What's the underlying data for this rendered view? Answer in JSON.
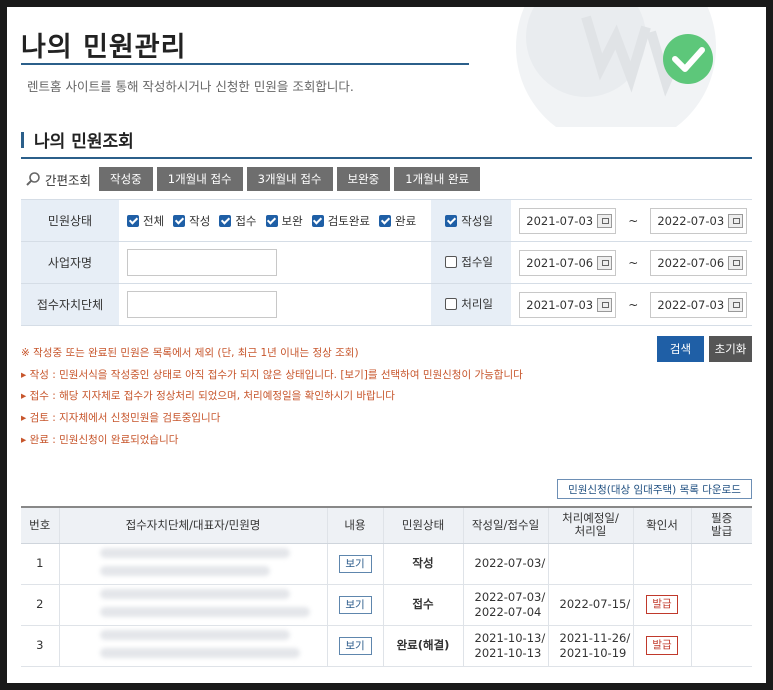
{
  "header": {
    "title": "나의 민원관리",
    "subtitle": "렌트홈 사이트를 통해 작성하시거나 신청한 민원을 조회합니다."
  },
  "section": {
    "title": "나의 민원조회"
  },
  "quick_search": {
    "label": "간편조회",
    "buttons": [
      "작성중",
      "1개월내 접수",
      "3개월내 접수",
      "보완중",
      "1개월내 완료"
    ]
  },
  "filter": {
    "status_label": "민원상태",
    "status_options": [
      {
        "label": "전체",
        "checked": true
      },
      {
        "label": "작성",
        "checked": true
      },
      {
        "label": "접수",
        "checked": true
      },
      {
        "label": "보완",
        "checked": true
      },
      {
        "label": "검토완료",
        "checked": true
      },
      {
        "label": "완료",
        "checked": true
      }
    ],
    "business_label": "사업자명",
    "business_value": "",
    "agency_label": "접수자치단체",
    "agency_value": "",
    "date_rows": [
      {
        "label": "작성일",
        "checked": true,
        "from": "2021-07-03",
        "to": "2022-07-03"
      },
      {
        "label": "접수일",
        "checked": false,
        "from": "2021-07-06",
        "to": "2022-07-06"
      },
      {
        "label": "처리일",
        "checked": false,
        "from": "2021-07-03",
        "to": "2022-07-03"
      }
    ],
    "tilde": "~"
  },
  "actions": {
    "search": "검색",
    "reset": "초기화"
  },
  "notes": [
    "※ 작성중 또는 완료된 민원은 목록에서 제외 (단, 최근 1년 이내는 정상 조회)",
    "▸ 작성 : 민원서식을 작성중인 상태로 아직 접수가 되지 않은 상태입니다. [보기]를 선택하여 민원신청이 가능합니다",
    "▸ 접수 : 해당 지자체로 접수가 정상처리 되었으며, 처리예정일을 확인하시기 바랍니다",
    "▸ 검토 : 지자체에서 신청민원을 검토중입니다",
    "▸ 완료 : 민원신청이 완료되었습니다"
  ],
  "download_label": "민원신청(대상 임대주택) 목록 다운로드",
  "table": {
    "headers": [
      "번호",
      "접수자치단체/대표자/민원명",
      "내용",
      "민원상태",
      "작성일/접수일",
      "처리예정일/\n처리일",
      "확인서",
      "필증\n발급"
    ],
    "rows": [
      {
        "no": "1",
        "view": "보기",
        "status": "작성",
        "dates": [
          "2022-07-03/",
          ""
        ],
        "due": [
          "",
          ""
        ],
        "cert": ""
      },
      {
        "no": "2",
        "view": "보기",
        "status": "접수",
        "dates": [
          "2022-07-03/",
          "2022-07-04"
        ],
        "due": [
          "2022-07-15/",
          ""
        ],
        "cert": "발급"
      },
      {
        "no": "3",
        "view": "보기",
        "status": "완료(해결)",
        "dates": [
          "2021-10-13/",
          "2021-10-13"
        ],
        "due": [
          "2021-11-26/",
          "2021-10-19"
        ],
        "cert": "발급"
      }
    ]
  },
  "colors": {
    "primary": "#1f5fa6",
    "note": "#c7552b",
    "accent_green": "#5dc77a"
  }
}
